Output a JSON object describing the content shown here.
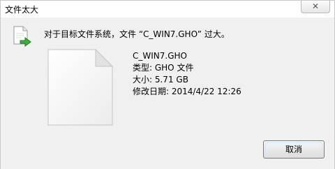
{
  "window": {
    "title": "文件太大",
    "close_label": "✕"
  },
  "message": {
    "text": "对于目标文件系统，文件 “C_WIN7.GHO” 过大。"
  },
  "file": {
    "name": "C_WIN7.GHO",
    "type_line": "类型: GHO 文件",
    "size_line": "大小: 5.71 GB",
    "modified_line": "修改日期: 2014/4/22 12:26"
  },
  "buttons": {
    "cancel_label": "取消"
  },
  "icons": {
    "message_icon": "file-copy-arrow-icon",
    "file_icon": "blank-document-icon"
  }
}
